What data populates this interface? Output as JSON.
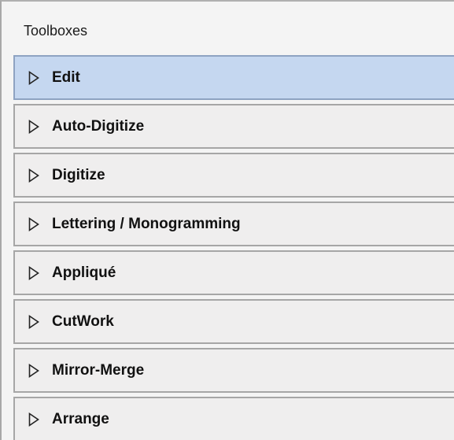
{
  "panel": {
    "title": "Toolboxes"
  },
  "toolboxes": [
    {
      "label": "Edit",
      "icon": "expand-arrow-icon",
      "selected": true
    },
    {
      "label": "Auto-Digitize",
      "icon": "expand-arrow-icon",
      "selected": false
    },
    {
      "label": "Digitize",
      "icon": "expand-arrow-icon",
      "selected": false
    },
    {
      "label": "Lettering / Monogramming",
      "icon": "expand-arrow-icon",
      "selected": false
    },
    {
      "label": "Appliqué",
      "icon": "expand-arrow-icon",
      "selected": false
    },
    {
      "label": "CutWork",
      "icon": "expand-arrow-icon",
      "selected": false
    },
    {
      "label": "Mirror-Merge",
      "icon": "expand-arrow-icon",
      "selected": false
    },
    {
      "label": "Arrange",
      "icon": "expand-arrow-icon",
      "selected": false
    }
  ],
  "colors": {
    "selected_background": "#c5d7f0",
    "header_background": "#efeeee",
    "panel_background": "#f4f4f4"
  }
}
